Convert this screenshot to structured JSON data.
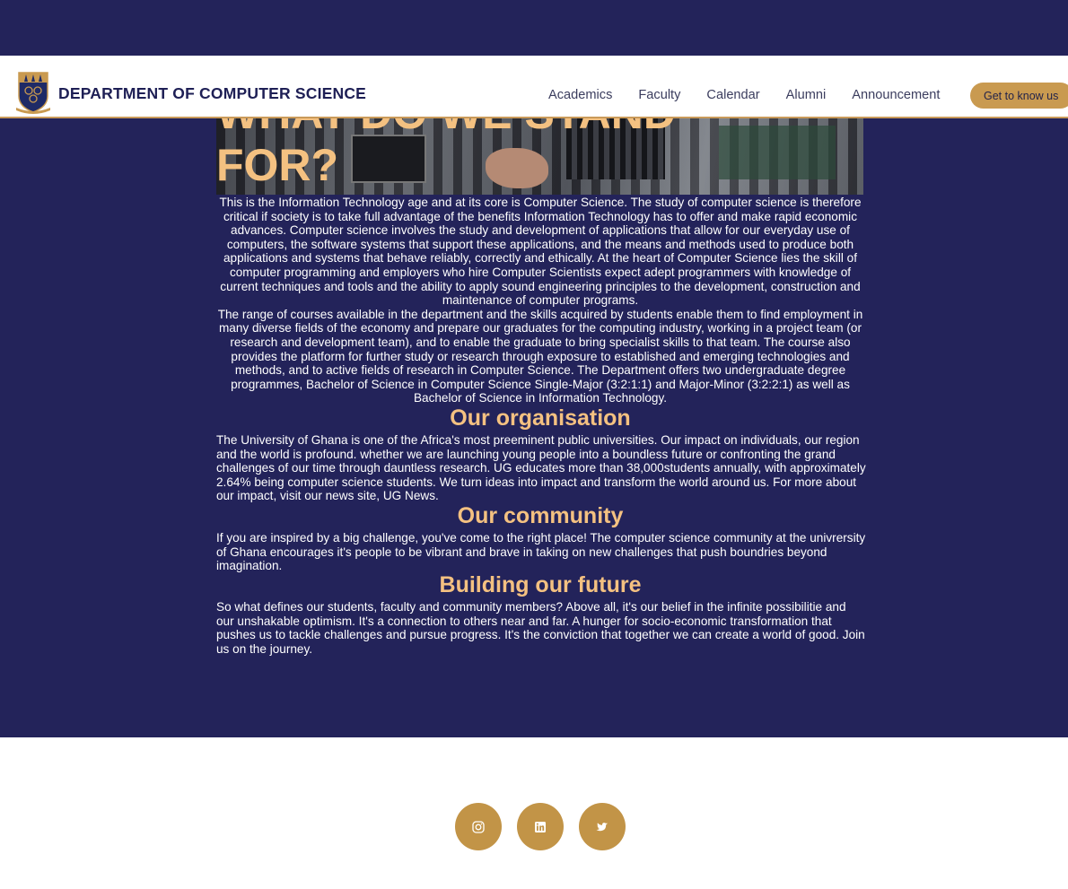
{
  "header": {
    "brand": "DEPARTMENT OF COMPUTER SCIENCE",
    "nav": [
      "Academics",
      "Faculty",
      "Calendar",
      "Alumni",
      "Announcement"
    ],
    "cta": "Get to know us"
  },
  "hero": {
    "title_line1": "WHAT DO WE STAND",
    "title_line2": "FOR?"
  },
  "intro": {
    "p1": "This is the Information Technology age and at its core is Computer Science. The study of computer science is therefore critical if society is to take full advantage of the benefits Information Technology has to offer and make rapid economic advances. Computer science involves the study and development of applications that allow for our everyday use of computers, the software systems that support these applications, and the means and methods used to produce both applications and systems that behave reliably, correctly and ethically. At the heart of Computer Science lies the skill of computer programming and employers who hire Computer Scientists expect adept programmers with knowledge of current techniques and tools and the ability to apply sound engineering principles to the development, construction and maintenance of computer programs.",
    "p2": "The range of courses available in the department and the skills acquired by students enable them to find employment in many diverse fields of the economy and prepare our graduates for the computing industry, working in a project team (or research and development team), and to enable the graduate to bring specialist skills to that team. The course also provides the platform for further study or research through exposure to established and emerging technologies and methods, and to active fields of research in Computer Science. The Department offers two undergraduate degree programmes, Bachelor of Science in Computer Science Single-Major (3:2:1:1) and Major-Minor (3:2:2:1) as well as Bachelor of Science in Information Technology."
  },
  "sections": [
    {
      "heading": "Our organisation",
      "body": "The University of Ghana is one of the Africa's most preeminent public universities. Our impact on individuals, our region and the world is profound. whether we are launching young people into a boundless future or confronting the grand challenges of our time through dauntless research. UG educates more than 38,000students annually, with approximately 2.64% being computer science students. We turn ideas into impact and transform the world around us. For more about our impact, visit our news site, UG News."
    },
    {
      "heading": "Our community",
      "body": "If you are inspired by a big challenge, you've come to the right place! The computer science community at the univrersity of Ghana encourages it's people to be vibrant and brave in taking on new challenges that push boundries beyond imagination."
    },
    {
      "heading": "Building our future",
      "body": "So what defines our students, faculty and community members? Above all, it's our belief in the infinite possibilitie and our unshakable optimism. It's a connection to others near and far. A hunger for socio-economic transformation that pushes us to tackle challenges and pursue progress. It's the conviction that together we can create a world of good. Join us on the journey."
    }
  ],
  "footer": {
    "social_icons": [
      "instagram-icon",
      "linkedin-icon",
      "twitter-icon"
    ]
  },
  "colors": {
    "navy": "#23235a",
    "gold": "#c99a50",
    "heading": "#f4c181"
  }
}
